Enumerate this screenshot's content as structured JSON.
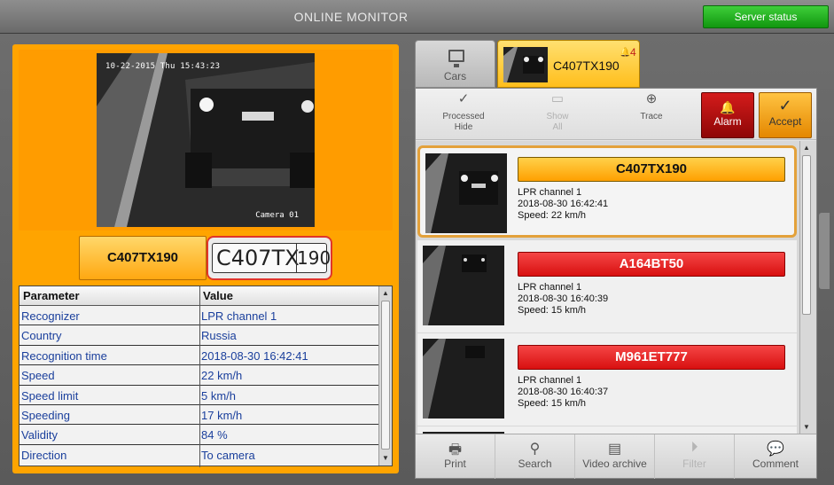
{
  "window": {
    "title": "ONLINE MONITOR",
    "server_status": "Server status"
  },
  "left": {
    "camera": {
      "timestamp": "10-22-2015 Thu 15:43:23",
      "label": "Camera 01"
    },
    "plate_button": "C407TX190",
    "plate_image": {
      "number": "C407TX",
      "region": "190"
    },
    "table": {
      "headers": {
        "param": "Parameter",
        "value": "Value"
      },
      "rows": [
        {
          "param": "Recognizer",
          "value": "LPR channel 1"
        },
        {
          "param": "Country",
          "value": "Russia"
        },
        {
          "param": "Recognition time",
          "value": "2018-08-30 16:42:41"
        },
        {
          "param": "Speed",
          "value": "22 km/h"
        },
        {
          "param": "Speed limit",
          "value": "5 km/h"
        },
        {
          "param": "Speeding",
          "value": "17 km/h"
        },
        {
          "param": "Validity",
          "value": "84 %"
        },
        {
          "param": "Direction",
          "value": "To camera"
        }
      ]
    }
  },
  "tabs": {
    "cars": "Cars",
    "plate": {
      "label": "C407TX190",
      "alarm_count": "4"
    }
  },
  "toolbar": {
    "processed_hide": "Processed Hide",
    "show_all": "Show All",
    "trace": "Trace",
    "alarm": "Alarm",
    "accept": "Accept"
  },
  "events": [
    {
      "plate": "C407TX190",
      "color": "yellow",
      "channel": "LPR channel 1",
      "time": "2018-08-30 16:42:41",
      "speed": "Speed: 22 km/h"
    },
    {
      "plate": "A164BT50",
      "color": "red",
      "channel": "LPR channel 1",
      "time": "2018-08-30 16:40:39",
      "speed": "Speed: 15 km/h"
    },
    {
      "plate": "M961ET777",
      "color": "red",
      "channel": "LPR channel 1",
      "time": "2018-08-30 16:40:37",
      "speed": "Speed: 15 km/h"
    }
  ],
  "bottom": {
    "print": "Print",
    "search": "Search",
    "video_archive": "Video archive",
    "filter": "Filter",
    "comment": "Comment"
  },
  "colors": {
    "accent": "#ffa400",
    "alarm": "#c0221a",
    "server_ok": "#2bb428"
  }
}
